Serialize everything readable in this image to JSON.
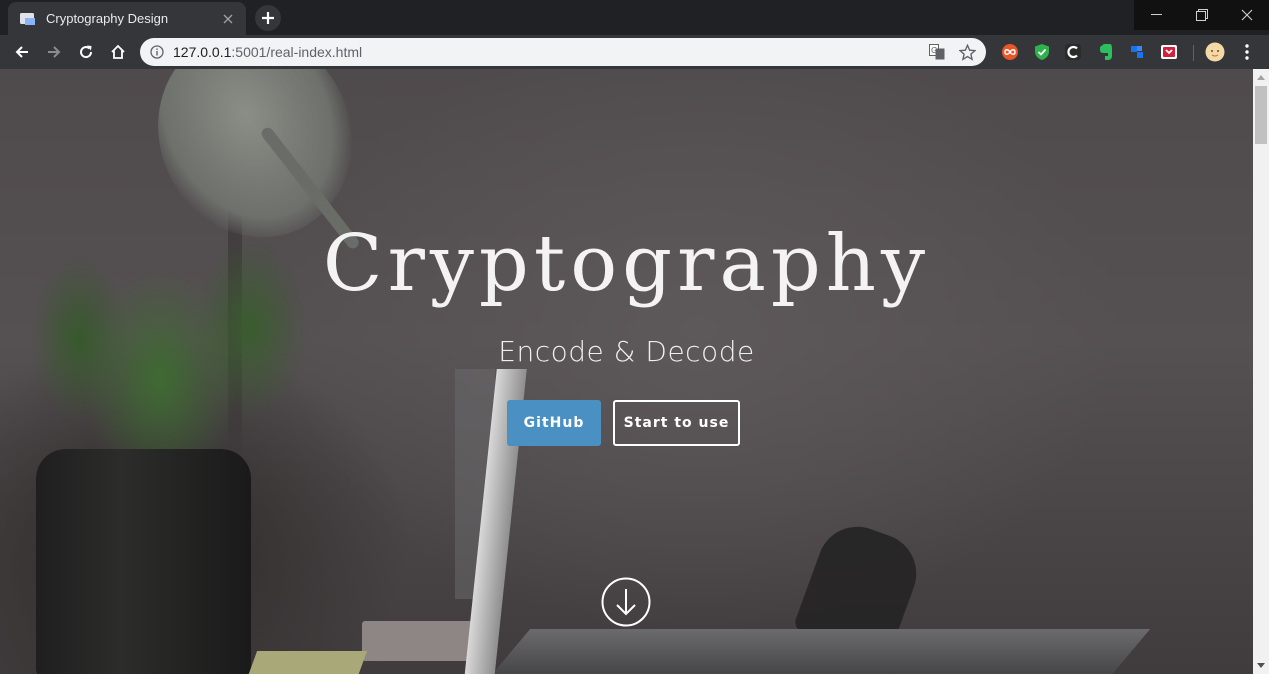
{
  "browser": {
    "tab_title": "Cryptography Design",
    "url_host": "127.0.0.1",
    "url_rest": ":5001/real-index.html"
  },
  "hero": {
    "title": "Cryptography",
    "subtitle": "Encode & Decode",
    "github_label": "GitHub",
    "start_label": "Start to use"
  },
  "colors": {
    "tab_background": "#35363a",
    "toolbar_background": "#35363a",
    "github_button": "#4a90c2",
    "title_text": "#f4f2f2"
  },
  "icons": {
    "tab_favicon": "page-icon",
    "tab_close": "close-icon",
    "new_tab": "plus-icon",
    "back": "back-arrow-icon",
    "forward": "forward-arrow-icon",
    "reload": "reload-icon",
    "home": "home-icon",
    "site_info": "info-icon",
    "translate": "translate-icon",
    "bookmark": "star-icon",
    "scroll_down": "arrow-down-circle-icon"
  }
}
